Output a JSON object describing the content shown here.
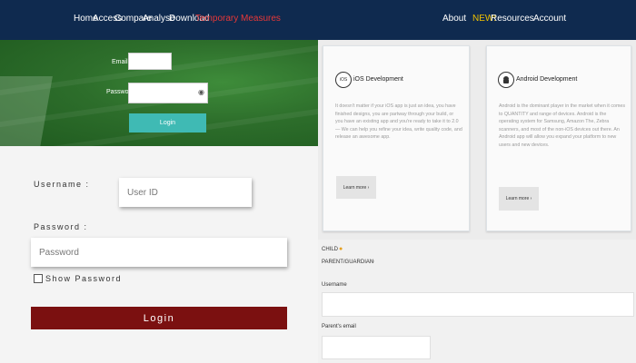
{
  "nav": {
    "home": "Home",
    "access": "Access",
    "compare": "Compare",
    "analyse": "Analyse",
    "download": "Download",
    "temporary": "Temporary Measures",
    "about": "About",
    "new_badge": "NEW!",
    "resources": "Resources",
    "account": "Account",
    "highlight_color": "#e63838",
    "badge_color": "#f2c200"
  },
  "hero_form": {
    "email_label": "Email",
    "password_label": "Password",
    "login_label": "Login"
  },
  "login_form": {
    "username_label": "Username :",
    "username_placeholder": "User ID",
    "password_label": "Password :",
    "password_placeholder": "Password",
    "show_password_label": "Show Password",
    "login_label": "Login"
  },
  "cards": [
    {
      "icon_text": "iOS",
      "title": "iOS Development",
      "body": "It doesn't matter if your iOS app is just an idea, you have finished designs, you are partway through your build, or you have an existing app and you're ready to take it to 2.0 — We can help you refine your idea, write quality code, and release an awesome app.",
      "button": "Learn more ›"
    },
    {
      "icon_text": "",
      "title": "Android Development",
      "body": "Android is the dominant player in the market when it comes to QUANTITY and range of devices. Android is the operating system for Samsung, Amazon The, Zebra scanners, and most of the non-iOS devices out there. An Android app will allow you expand your platform to new users and new devices.",
      "button": "Learn more ›"
    }
  ],
  "account_type": {
    "child": "CHILD",
    "parent": "PARENT/GUARDIAN",
    "username_label": "Username",
    "parent_email_label": "Parent's email"
  }
}
